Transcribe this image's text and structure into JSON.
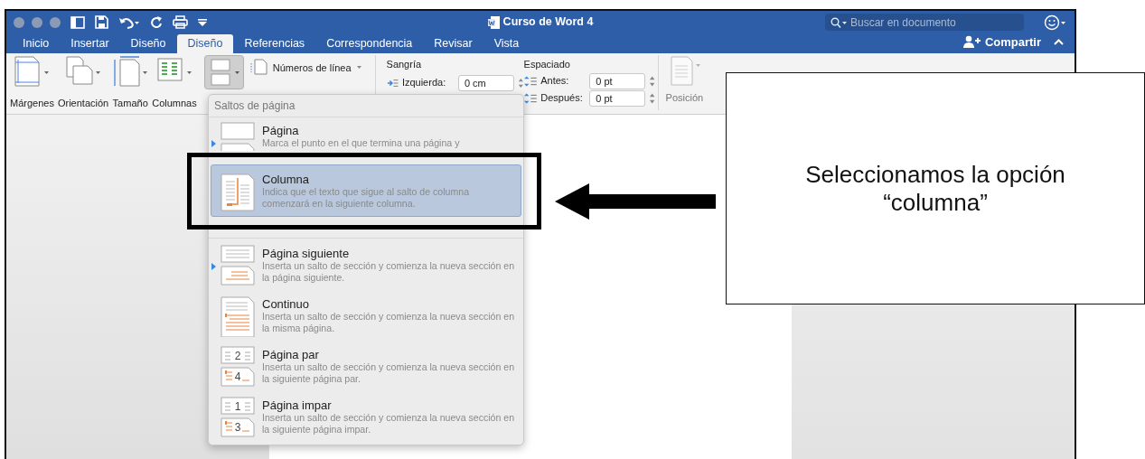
{
  "window": {
    "title": "Curso de Word 4",
    "search": {
      "placeholder": "Buscar en documento"
    }
  },
  "tabs": [
    {
      "label": "Inicio",
      "selected": false
    },
    {
      "label": "Insertar",
      "selected": false
    },
    {
      "label": "Diseño",
      "selected": false
    },
    {
      "label": "Diseño",
      "selected": true
    },
    {
      "label": "Referencias",
      "selected": false
    },
    {
      "label": "Correspondencia",
      "selected": false
    },
    {
      "label": "Revisar",
      "selected": false
    },
    {
      "label": "Vista",
      "selected": false
    }
  ],
  "share": {
    "label": "Compartir"
  },
  "ribbon": {
    "buttons": [
      {
        "label": "Márgenes",
        "kind": "margins"
      },
      {
        "label": "Orientación",
        "kind": "orientation"
      },
      {
        "label": "Tamaño",
        "kind": "size"
      },
      {
        "label": "Columnas",
        "kind": "columns"
      }
    ],
    "breaks_pressed": true,
    "line_numbers": "Números de línea",
    "indent": {
      "title": "Sangría",
      "label": "Izquierda:",
      "value": "0 cm"
    },
    "spacing": {
      "title": "Espaciado",
      "fields": [
        {
          "label": "Antes:",
          "value": "0 pt"
        },
        {
          "label": "Después:",
          "value": "0 pt"
        }
      ]
    },
    "position": "Posición"
  },
  "breaks_menu": {
    "header": "Saltos de página",
    "sections": [
      {
        "items": [
          {
            "kind": "page",
            "title": "Página",
            "description": "Marca el punto en el que termina una página y",
            "selected": false,
            "marked": true
          },
          {
            "kind": "column",
            "title": "Columna",
            "description": "Indica que el texto que sigue al salto de columna comenzará en la siguiente columna.",
            "selected": true,
            "marked": false
          }
        ]
      },
      {
        "items": [
          {
            "kind": "next",
            "title": "Página siguiente",
            "description": "Inserta un salto de sección y comienza la nueva sección en la página siguiente.",
            "selected": false,
            "marked": true
          },
          {
            "kind": "continuous",
            "title": "Continuo",
            "description": "Inserta un salto de sección y comienza la nueva sección en la misma página.",
            "selected": false,
            "marked": false
          },
          {
            "kind": "numbered",
            "icon_numbers": [
              "2",
              "4"
            ],
            "title": "Página par",
            "description": "Inserta un salto de sección y comienza la nueva sección en la siguiente página par.",
            "selected": false,
            "marked": false
          },
          {
            "kind": "numbered",
            "icon_numbers": [
              "1",
              "3"
            ],
            "title": "Página impar",
            "description": "Inserta un salto de sección y comienza la nueva sección en la siguiente página impar.",
            "selected": false,
            "marked": false
          }
        ]
      }
    ]
  },
  "annotation": {
    "callout": "Seleccionamos la opción “columna”"
  }
}
